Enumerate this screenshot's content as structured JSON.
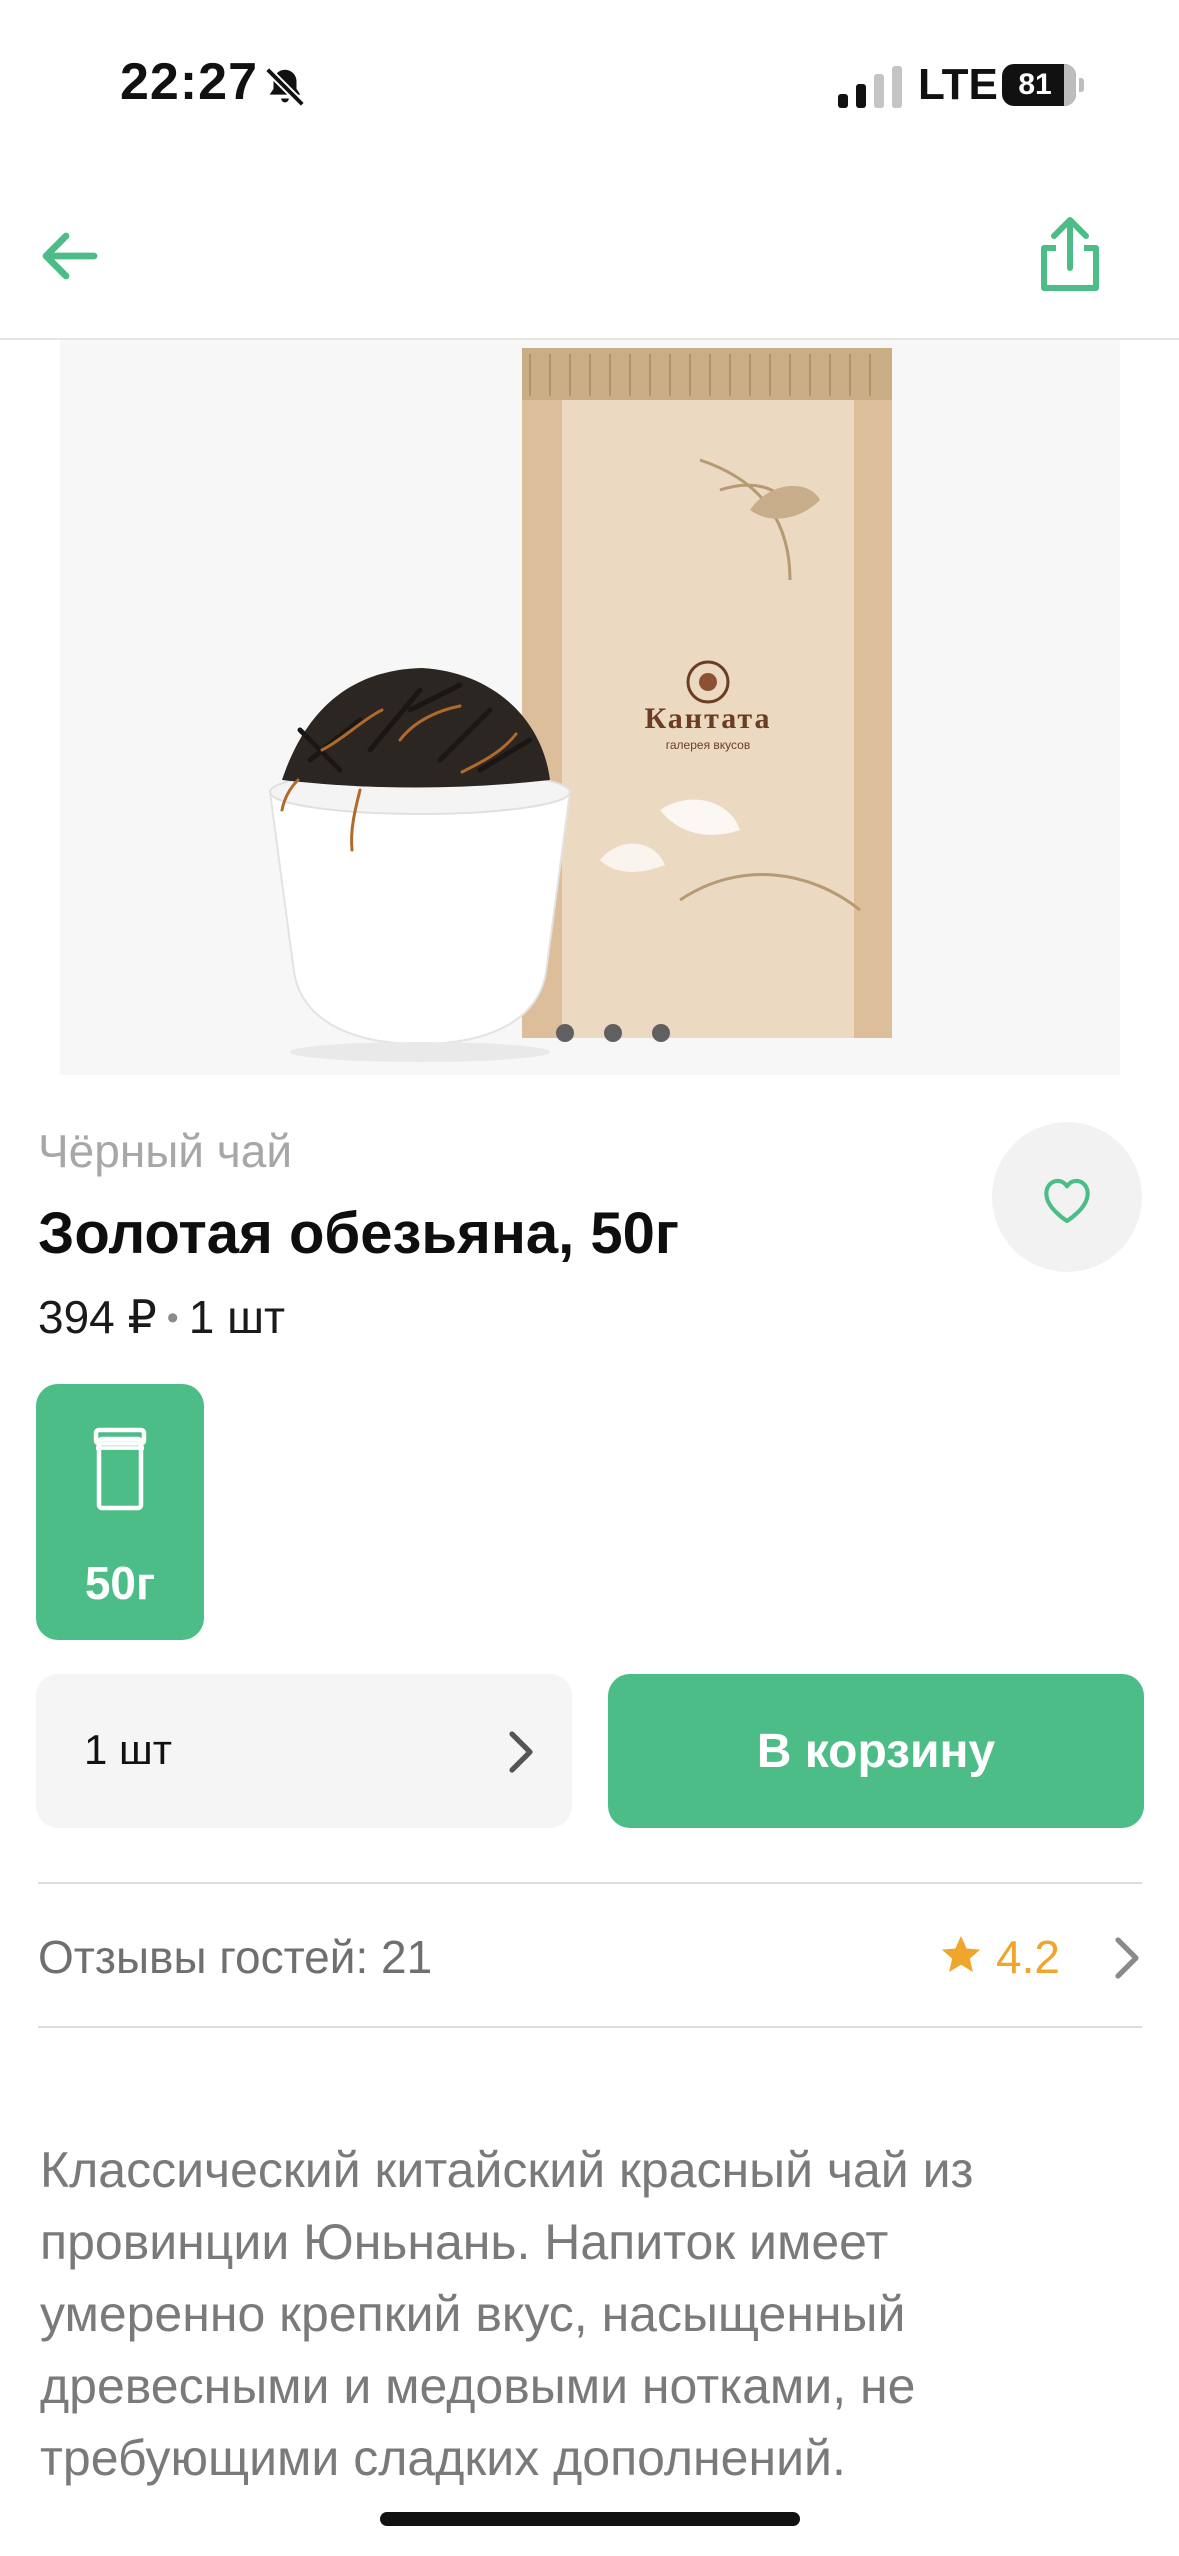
{
  "status_bar": {
    "time": "22:27",
    "network": "LTE",
    "battery": "81"
  },
  "nav": {
    "back_icon": "arrow-left-icon",
    "share_icon": "share-icon"
  },
  "product_image": {
    "brand": "Кантата",
    "brand_subtitle": "галерея вкусов",
    "carousel_pages": 3
  },
  "product": {
    "category": "Чёрный чай",
    "title": "Золотая обезьяна, 50г",
    "price": "394 ₽",
    "unit": "1 шт"
  },
  "weight_options": [
    {
      "label": "50г",
      "selected": true
    }
  ],
  "quantity": {
    "label": "1 шт"
  },
  "cart_button": {
    "label": "В корзину"
  },
  "reviews": {
    "label": "Отзывы гостей: 21",
    "rating": "4.2"
  },
  "description": "Классический китайский красный чай из провинции Юньнань. Напиток имеет умеренно крепкий вкус, насыщенный древесными и медовыми нотками, не требующими сладких дополнений.",
  "colors": {
    "accent": "#4dbd88",
    "star": "#f0a52c",
    "muted_text": "#a7a7a7"
  }
}
